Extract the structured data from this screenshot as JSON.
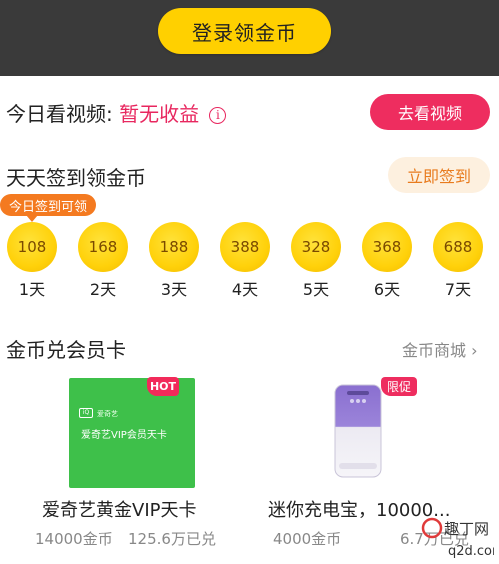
{
  "header": {
    "login_label": "登录领金币"
  },
  "video": {
    "label": "今日看视频:",
    "status": "暂无收益",
    "info_icon": "info-icon",
    "button": "去看视频"
  },
  "sign": {
    "title": "天天签到领金币",
    "button": "立即签到",
    "tag": "今日签到可领",
    "days": [
      {
        "coins": "108",
        "day": "1天"
      },
      {
        "coins": "168",
        "day": "2天"
      },
      {
        "coins": "188",
        "day": "3天"
      },
      {
        "coins": "388",
        "day": "4天"
      },
      {
        "coins": "328",
        "day": "5天"
      },
      {
        "coins": "368",
        "day": "6天"
      },
      {
        "coins": "688",
        "day": "7天"
      }
    ]
  },
  "exchange": {
    "title": "金币兑会员卡",
    "mall_link": "金币商城 ›",
    "products": [
      {
        "badge": "HOT",
        "card_brand": "爱奇艺",
        "card_text": "爱奇艺VIP会员天卡",
        "name": "爱奇艺黄金VIP天卡",
        "price": "14000金币",
        "count": "125.6万已兑"
      },
      {
        "badge": "限促",
        "name": "迷你充电宝，10000...",
        "price": "4000金币",
        "count": "6.7万已兑"
      }
    ]
  },
  "watermark": {
    "line1": "趣丁网",
    "line2": "q2d.com"
  },
  "colors": {
    "accent_yellow": "#ffd000",
    "accent_pink": "#ee2d5f",
    "sign_orange": "#f47a20",
    "card_green": "#3ec04a"
  }
}
